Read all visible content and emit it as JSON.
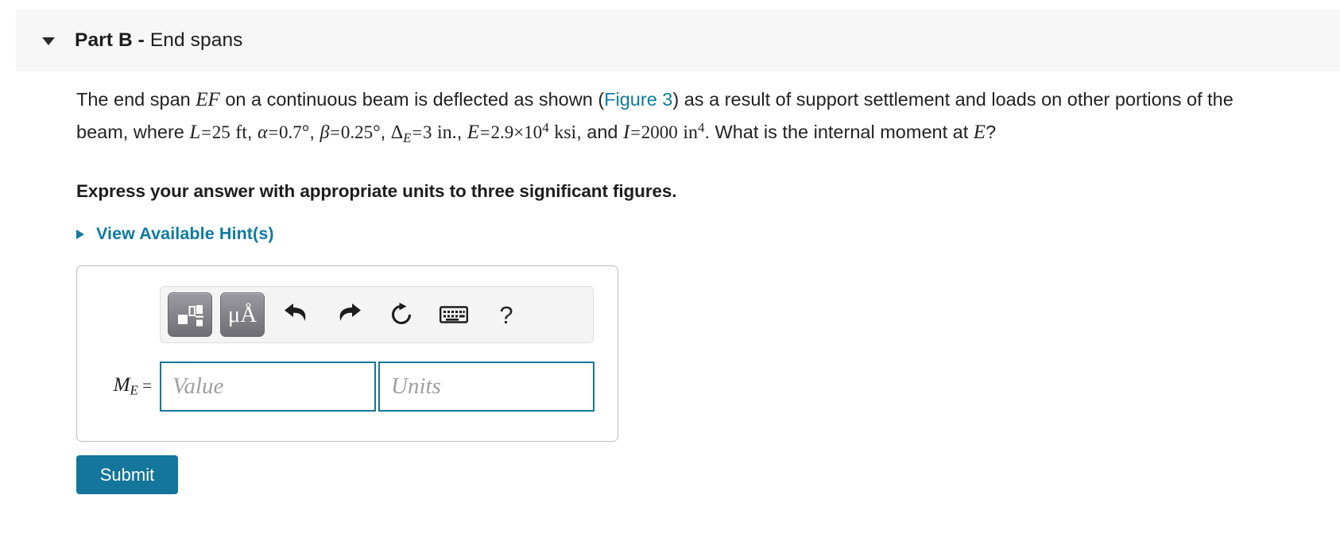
{
  "header": {
    "caret_icon": "caret-down-icon",
    "part_label": "Part B",
    "separator": " - ",
    "part_name": "End spans"
  },
  "statement": {
    "l1_a": "The end span ",
    "l1_ef": "EF",
    "l1_b": " on a continuous beam is deflected as shown (",
    "figure_link": "Figure 3",
    "l1_c": ") as a result of support settlement and loads on other portions",
    "l2_a": "of the beam, where ",
    "sym_L": "L",
    "eq": "=",
    "val_L": "25",
    "unit_ft": "ft",
    "comma": ", ",
    "sym_alpha": "α",
    "val_alpha": "0.7",
    "deg": "°",
    "sym_beta": "β",
    "val_beta": "0.25",
    "sym_delta": "Δ",
    "sym_delta_sub": "E",
    "val_delta": "3",
    "unit_in": "in.",
    "sym_E": "E",
    "val_E": "2.9×10",
    "val_E_exp": "4",
    "unit_ksi": "ksi",
    "and": ", and ",
    "sym_I": "I",
    "val_I": "2000",
    "unit_in4": "in",
    "unit_in4_exp": "4",
    "l2_end": ". What is the internal",
    "l3_a": "moment at ",
    "sym_E2": "E",
    "l3_b": "?"
  },
  "instruction": "Express your answer with appropriate units to three significant figures.",
  "hints": {
    "arrow_icon": "triangle-right-icon",
    "label": "View Available Hint(s)"
  },
  "answer": {
    "toolbar": [
      {
        "name": "template-palette-button",
        "icon": "math-template-icon",
        "label": ""
      },
      {
        "name": "units-palette-button",
        "icon": "mu-angstrom-icon",
        "label": "μÅ"
      },
      {
        "name": "undo-button",
        "icon": "undo-arrow-icon",
        "label": ""
      },
      {
        "name": "redo-button",
        "icon": "redo-arrow-icon",
        "label": ""
      },
      {
        "name": "reset-button",
        "icon": "refresh-circle-icon",
        "label": ""
      },
      {
        "name": "keyboard-button",
        "icon": "keyboard-icon",
        "label": ""
      },
      {
        "name": "help-button",
        "icon": "question-mark-icon",
        "label": "?"
      }
    ],
    "variable": "M",
    "variable_sub": "E",
    "equals": "=",
    "value_placeholder": "Value",
    "units_placeholder": "Units",
    "value_current": "",
    "units_current": ""
  },
  "submit_label": "Submit",
  "colors": {
    "accent_teal": "#13769a",
    "link_teal": "#0f7b9e",
    "header_bg": "#f7f7f7",
    "toolbar_bg": "#f4f4f4",
    "placeholder_gray": "#9f9f9f"
  }
}
